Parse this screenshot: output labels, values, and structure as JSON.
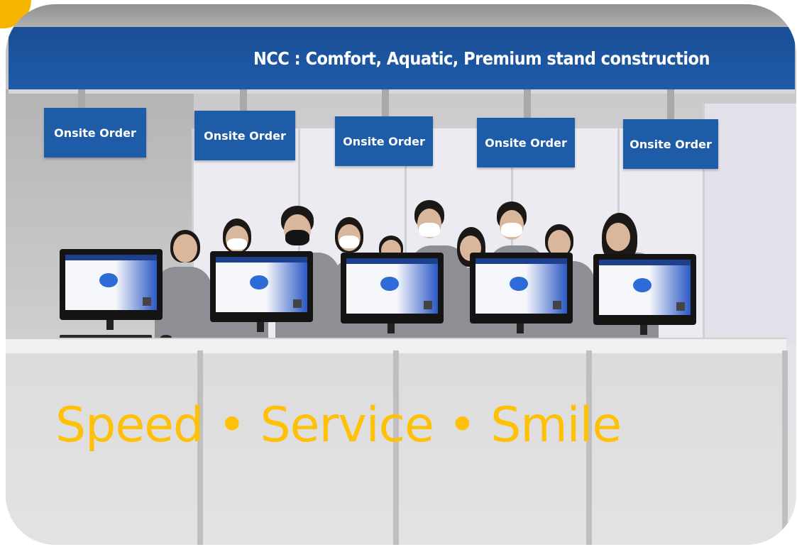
{
  "banner": {
    "text": "NCC : Comfort, Aquatic, Premium stand construction"
  },
  "signs": [
    {
      "label": "Onsite Order"
    },
    {
      "label": "Onsite Order"
    },
    {
      "label": "Onsite Order"
    },
    {
      "label": "Onsite Order"
    },
    {
      "label": "Onsite Order"
    }
  ],
  "slogan": {
    "text": "Speed • Service • Smile"
  },
  "colors": {
    "banner_blue": "#1e5aa8",
    "slogan_yellow": "#ffc107",
    "accent_corner": "#f5b400"
  }
}
